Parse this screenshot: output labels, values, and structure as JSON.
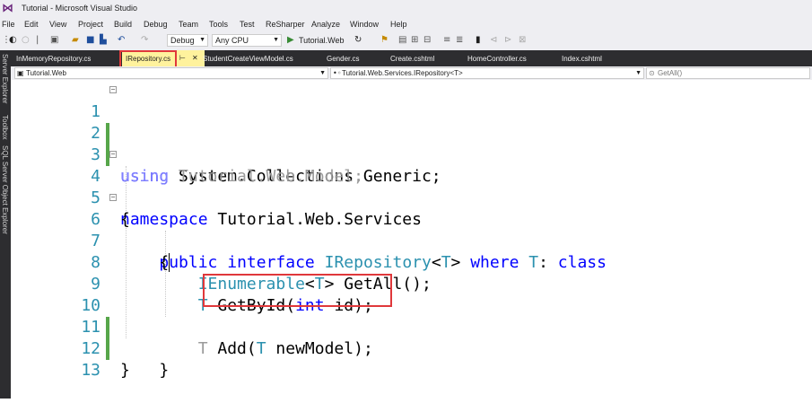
{
  "window": {
    "title": "Tutorial - Microsoft Visual Studio"
  },
  "menu": [
    "File",
    "Edit",
    "View",
    "Project",
    "Build",
    "Debug",
    "Team",
    "Tools",
    "Test",
    "ReSharper",
    "Analyze",
    "Window",
    "Help"
  ],
  "toolbar": {
    "configuration": "Debug",
    "platform": "Any CPU",
    "start_label": "Tutorial.Web"
  },
  "dock": [
    "Server Explorer",
    "Toolbox",
    "SQL Server Object Explorer"
  ],
  "tabs": [
    {
      "label": "InMemoryRepository.cs",
      "active": false
    },
    {
      "label": "IRepository.cs",
      "active": true
    },
    {
      "label": "StudentCreateViewModel.cs",
      "active": false
    },
    {
      "label": "Gender.cs",
      "active": false
    },
    {
      "label": "Create.cshtml",
      "active": false
    },
    {
      "label": "HomeController.cs",
      "active": false
    },
    {
      "label": "Index.cshtml",
      "active": false
    }
  ],
  "nav": {
    "project": "Tutorial.Web",
    "type": "Tutorial.Web.Services.IRepository<T>",
    "member": "GetAll()"
  },
  "code": {
    "line_numbers": [
      "1",
      "2",
      "3",
      "4",
      "5",
      "6",
      "7",
      "8",
      "9",
      "10",
      "11",
      "12",
      "13"
    ],
    "l1_kw": "using",
    "l1_rest": " System.Collections.Generic;",
    "l2_kw": "using",
    "l2_rest": " Tutorial.Web.Model;",
    "l4_kw": "namespace",
    "l4_rest": " Tutorial.Web.Services",
    "l5": "{",
    "l6_kw1": "public",
    "l6_kw2": "interface",
    "l6_type": "IRepository",
    "l6_lt": "<",
    "l6_T": "T",
    "l6_gt": ">",
    "l6_kw3": "where",
    "l6_T2": "T",
    "l6_colon": ":",
    "l6_kw4": "class",
    "l7": "{",
    "l8_type": "IEnumerable",
    "l8_lt": "<",
    "l8_T": "T",
    "l8_rest": "> GetAll();",
    "l9_T": "T",
    "l9_mid": " GetById(",
    "l9_kw": "int",
    "l9_rest": " id);",
    "l10_T": "T",
    "l10_mid": " Add(",
    "l10_T2": "T",
    "l10_rest": " newModel);",
    "l11": "}",
    "l12": "}"
  },
  "colors": {
    "keyword": "#0000ff",
    "type": "#2b91af",
    "highlight": "#e0383b",
    "active_tab": "#fff29d",
    "change_bar": "#57a64a"
  },
  "icons": [
    "vs-logo-icon",
    "back-icon",
    "forward-icon",
    "save-icon",
    "save-all-icon",
    "undo-icon",
    "redo-icon",
    "start-icon",
    "refresh-icon",
    "pin-icon",
    "close-icon",
    "csharp-file-icon",
    "class-icon",
    "method-icon"
  ]
}
